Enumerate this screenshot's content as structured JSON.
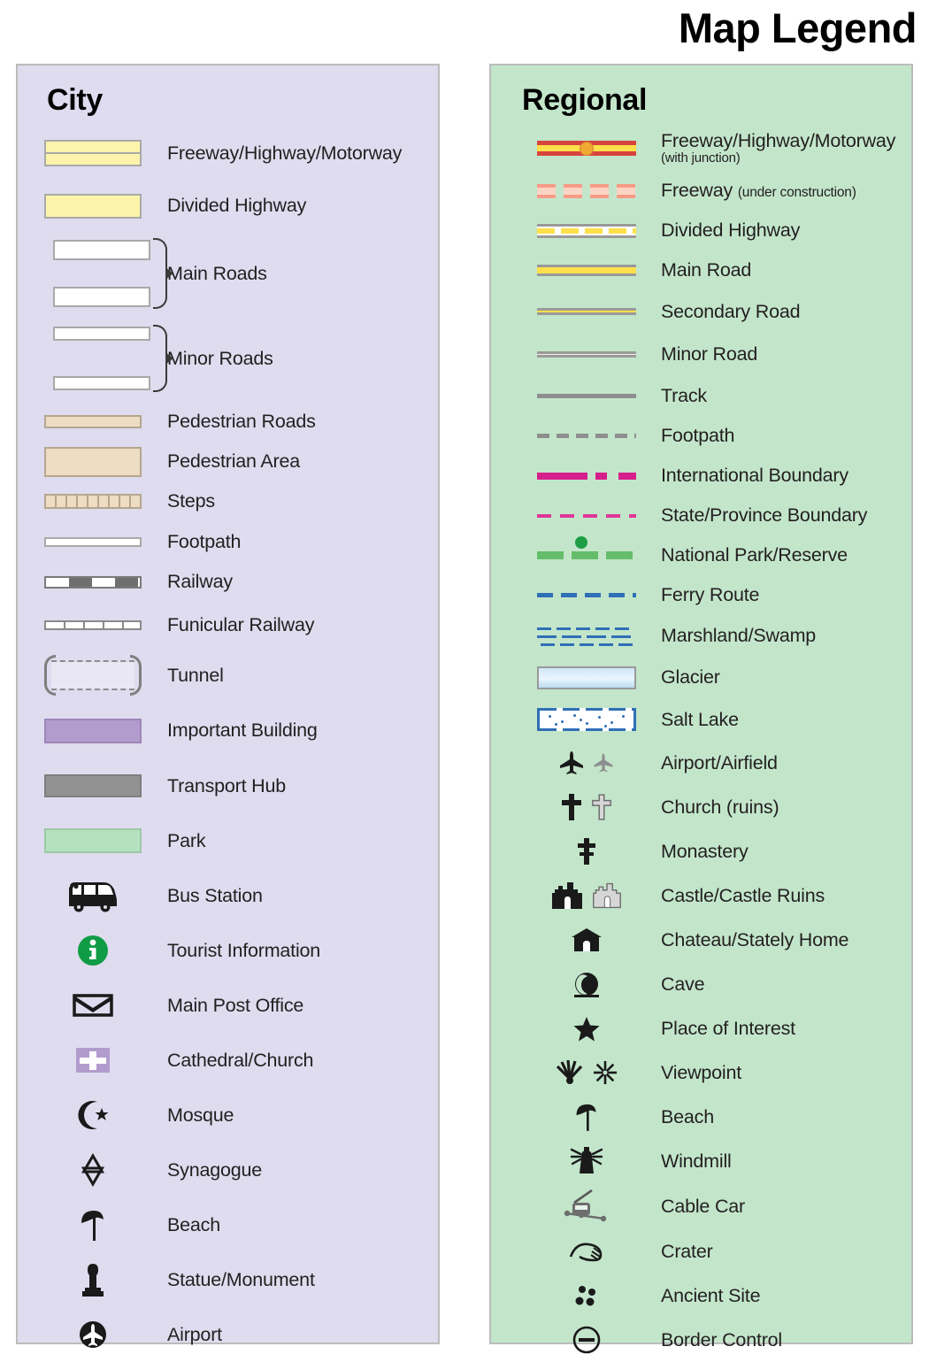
{
  "title": "Map Legend",
  "city": {
    "heading": "City",
    "items": [
      {
        "label": "Freeway/Highway/Motorway",
        "symbol": "freeway-swatch"
      },
      {
        "label": "Divided Highway",
        "symbol": "divided-highway-swatch"
      },
      {
        "label": "Main Roads",
        "symbol": "main-roads-brace-swatch"
      },
      {
        "label": "Minor Roads",
        "symbol": "minor-roads-brace-swatch"
      },
      {
        "label": "Pedestrian Roads",
        "symbol": "pedestrian-road-swatch"
      },
      {
        "label": "Pedestrian Area",
        "symbol": "pedestrian-area-swatch"
      },
      {
        "label": "Steps",
        "symbol": "steps-swatch"
      },
      {
        "label": "Footpath",
        "symbol": "footpath-swatch"
      },
      {
        "label": "Railway",
        "symbol": "railway-swatch"
      },
      {
        "label": "Funicular Railway",
        "symbol": "funicular-railway-swatch"
      },
      {
        "label": "Tunnel",
        "symbol": "tunnel-swatch"
      },
      {
        "label": "Important Building",
        "symbol": "important-building-swatch"
      },
      {
        "label": "Transport Hub",
        "symbol": "transport-hub-swatch"
      },
      {
        "label": "Park",
        "symbol": "park-swatch"
      },
      {
        "label": "Bus Station",
        "symbol": "bus-icon"
      },
      {
        "label": "Tourist Information",
        "symbol": "tourist-information-icon"
      },
      {
        "label": "Main Post Office",
        "symbol": "envelope-icon"
      },
      {
        "label": "Cathedral/Church",
        "symbol": "cathedral-cross-icon"
      },
      {
        "label": "Mosque",
        "symbol": "crescent-star-icon"
      },
      {
        "label": "Synagogue",
        "symbol": "star-of-david-icon"
      },
      {
        "label": "Beach",
        "symbol": "parasol-icon"
      },
      {
        "label": "Statue/Monument",
        "symbol": "statue-icon"
      },
      {
        "label": "Airport",
        "symbol": "airport-circle-icon"
      }
    ]
  },
  "regional": {
    "heading": "Regional",
    "items": [
      {
        "label": "Freeway/Highway/Motorway",
        "sublabel": "(with junction)",
        "symbol": "regional-freeway-swatch"
      },
      {
        "label": "Freeway",
        "inline_sublabel": "(under construction)",
        "symbol": "freeway-under-construction-swatch"
      },
      {
        "label": "Divided Highway",
        "symbol": "regional-divided-highway-swatch"
      },
      {
        "label": "Main Road",
        "symbol": "regional-main-road-swatch"
      },
      {
        "label": "Secondary Road",
        "symbol": "secondary-road-swatch"
      },
      {
        "label": "Minor Road",
        "symbol": "regional-minor-road-swatch"
      },
      {
        "label": "Track",
        "symbol": "track-swatch"
      },
      {
        "label": "Footpath",
        "symbol": "regional-footpath-swatch"
      },
      {
        "label": "International Boundary",
        "symbol": "international-boundary-swatch"
      },
      {
        "label": "State/Province Boundary",
        "symbol": "state-boundary-swatch"
      },
      {
        "label": "National Park/Reserve",
        "symbol": "national-park-swatch"
      },
      {
        "label": "Ferry Route",
        "symbol": "ferry-route-swatch"
      },
      {
        "label": "Marshland/Swamp",
        "symbol": "marshland-swatch"
      },
      {
        "label": "Glacier",
        "symbol": "glacier-swatch"
      },
      {
        "label": "Salt Lake",
        "symbol": "salt-lake-swatch"
      },
      {
        "label": "Airport/Airfield",
        "symbol": "airplane-pair-icon"
      },
      {
        "label": "Church (ruins)",
        "symbol": "church-ruins-cross-icon"
      },
      {
        "label": "Monastery",
        "symbol": "monastery-cross-icon"
      },
      {
        "label": "Castle/Castle Ruins",
        "symbol": "castle-pair-icon"
      },
      {
        "label": "Chateau/Stately Home",
        "symbol": "chateau-icon"
      },
      {
        "label": "Cave",
        "symbol": "cave-icon"
      },
      {
        "label": "Place of Interest",
        "symbol": "star-icon"
      },
      {
        "label": "Viewpoint",
        "symbol": "viewpoint-icon"
      },
      {
        "label": "Beach",
        "symbol": "parasol-icon"
      },
      {
        "label": "Windmill",
        "symbol": "windmill-icon"
      },
      {
        "label": "Cable Car",
        "symbol": "cable-car-icon"
      },
      {
        "label": "Crater",
        "symbol": "crater-icon"
      },
      {
        "label": "Ancient Site",
        "symbol": "ancient-site-icon"
      },
      {
        "label": "Border Control",
        "symbol": "border-control-icon"
      }
    ]
  },
  "colors": {
    "city_panel_bg": "#dedcee",
    "regional_panel_bg": "#c3e6cb",
    "panel_border": "#bcbcbc",
    "road_yellow": "#fde04a",
    "city_road_yellow": "#fdf4ac",
    "pedestrian_tan": "#eedcc3",
    "important_building_purple": "#b29ccd",
    "transport_hub_gray": "#929292",
    "park_green": "#b4e2bf",
    "freeway_red": "#d8443c",
    "junction_orange": "#f0a830",
    "boundary_magenta": "#d61e8c",
    "park_line_green": "#64bd6a",
    "ferry_blue": "#2f6fb5",
    "tourist_info_green": "#0f9c45",
    "text": "#231f20"
  }
}
